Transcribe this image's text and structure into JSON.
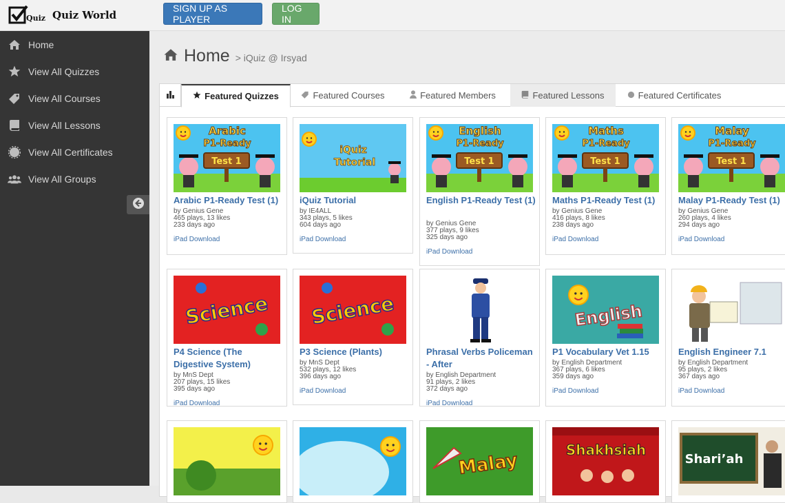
{
  "header": {
    "logo_text": "Quiz World",
    "logo_mark": "Quiz",
    "signup_label": "SIGN UP AS PLAYER",
    "login_label": "LOG IN"
  },
  "sidebar": {
    "items": [
      {
        "label": "Home",
        "icon": "home-icon"
      },
      {
        "label": "View All Quizzes",
        "icon": "star-icon"
      },
      {
        "label": "View All Courses",
        "icon": "tag-icon"
      },
      {
        "label": "View All Lessons",
        "icon": "book-icon"
      },
      {
        "label": "View All Certificates",
        "icon": "certificate-icon"
      },
      {
        "label": "View All Groups",
        "icon": "users-icon"
      }
    ]
  },
  "breadcrumb": {
    "title": "Home",
    "sub": "> iQuiz @ Irsyad"
  },
  "tabs": [
    {
      "label": "Featured Quizzes"
    },
    {
      "label": "Featured Courses"
    },
    {
      "label": "Featured Members"
    },
    {
      "label": "Featured Lessons"
    },
    {
      "label": "Featured Certificates"
    }
  ],
  "cards": [
    {
      "title": "Arabic P1-Ready Test (1)",
      "author": "by Genius Gene",
      "stats": "465 plays, 13 likes",
      "age": "233 days ago",
      "download": "iPad Download",
      "thumb_title": "Arabic",
      "thumb_sub": "P1-Ready",
      "thumb_board": "Test 1"
    },
    {
      "title": "iQuiz Tutorial",
      "author": "by IE4ALL",
      "stats": "343 plays, 5 likes",
      "age": "604 days ago",
      "download": "iPad Download",
      "thumb_title": "iQuiz",
      "thumb_sub": "Tutorial",
      "thumb_board": ""
    },
    {
      "title": "English P1-Ready Test (1)",
      "author": "by Genius Gene",
      "stats": "377 plays, 9 likes",
      "age": "325 days ago",
      "download": "iPad Download",
      "thumb_title": "English",
      "thumb_sub": "P1-Ready",
      "thumb_board": "Test 1"
    },
    {
      "title": "Maths P1-Ready Test (1)",
      "author": "by Genius Gene",
      "stats": "416 plays, 8 likes",
      "age": "238 days ago",
      "download": "iPad Download",
      "thumb_title": "Maths",
      "thumb_sub": "P1-Ready",
      "thumb_board": "Test 1"
    },
    {
      "title": "Malay P1-Ready Test (1)",
      "author": "by Genius Gene",
      "stats": "260 plays, 4 likes",
      "age": "294 days ago",
      "download": "iPad Download",
      "thumb_title": "Malay",
      "thumb_sub": "P1-Ready",
      "thumb_board": "Test 1"
    },
    {
      "title": "P4 Science (The Digestive System)",
      "author": "by MnS Dept",
      "stats": "207 plays, 15 likes",
      "age": "395 days ago",
      "download": "iPad Download",
      "thumb_title": "Science"
    },
    {
      "title": "P3 Science (Plants)",
      "author": "by MnS Dept",
      "stats": "532 plays, 12 likes",
      "age": "396 days ago",
      "download": "iPad Download",
      "thumb_title": "Science"
    },
    {
      "title": "Phrasal Verbs Policeman - After",
      "author": "by English Department",
      "stats": "91 plays, 2 likes",
      "age": "372 days ago",
      "download": "iPad Download"
    },
    {
      "title": "P1 Vocabulary Vet 1.15",
      "author": "by English Department",
      "stats": "367 plays, 6 likes",
      "age": "359 days ago",
      "download": "iPad Download",
      "thumb_title": "English"
    },
    {
      "title": "English Engineer 7.1",
      "author": "by English Department",
      "stats": "95 plays, 2 likes",
      "age": "367 days ago",
      "download": "iPad Download"
    },
    {
      "thumb_title": ""
    },
    {
      "thumb_title": ""
    },
    {
      "thumb_title": "Malay"
    },
    {
      "thumb_title": "Shakhsiah"
    },
    {
      "thumb_title": "Shari’ah"
    }
  ],
  "colors": {
    "sidebar_bg": "#353535",
    "link": "#3c6fa8",
    "signup": "#3b78b8",
    "login": "#69a86b"
  }
}
